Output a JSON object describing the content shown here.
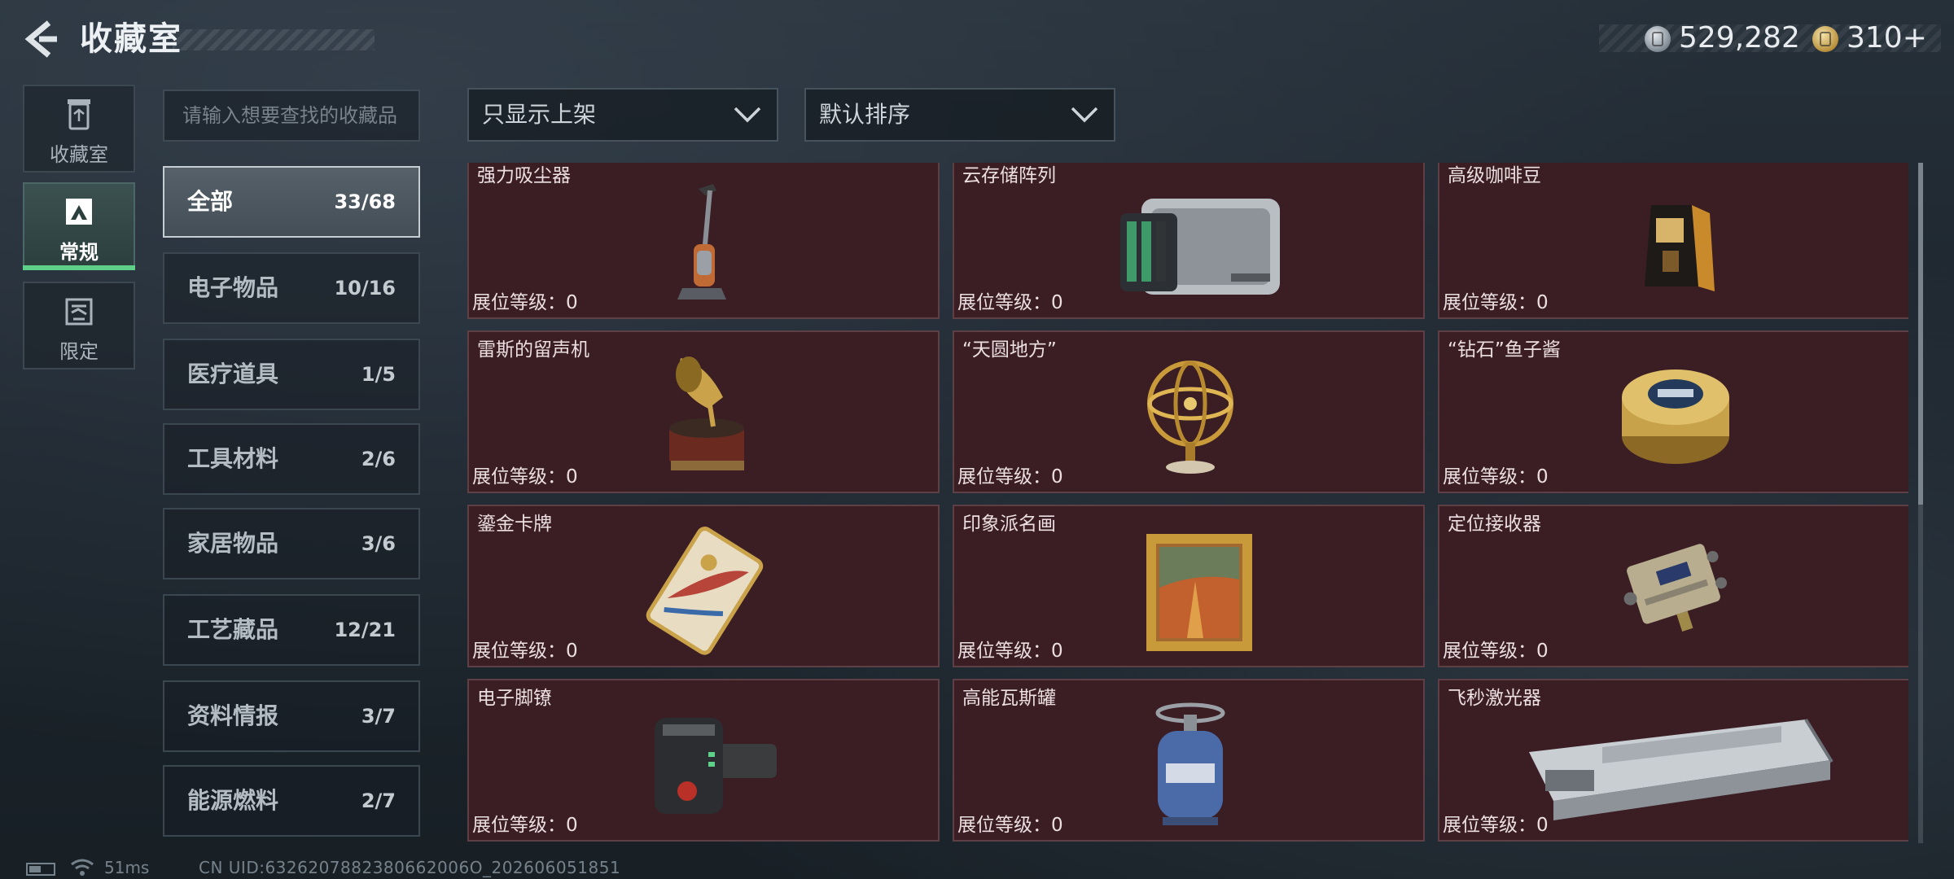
{
  "header": {
    "title": "收藏室",
    "currency_silver": "529,282",
    "currency_gold": "310+"
  },
  "nav": {
    "items": [
      {
        "label": "收藏室",
        "icon": "trash-can-icon"
      },
      {
        "label": "常规",
        "icon": "image-frame-icon",
        "selected": true
      },
      {
        "label": "限定",
        "icon": "limited-icon"
      }
    ]
  },
  "search": {
    "placeholder": "请输入想要查找的收藏品",
    "value": ""
  },
  "filters": {
    "filter_label": "只显示上架",
    "sort_label": "默认排序"
  },
  "categories": [
    {
      "name": "全部",
      "count": "33/68",
      "active": true
    },
    {
      "name": "电子物品",
      "count": "10/16"
    },
    {
      "name": "医疗道具",
      "count": "1/5"
    },
    {
      "name": "工具材料",
      "count": "2/6"
    },
    {
      "name": "家居物品",
      "count": "3/6"
    },
    {
      "name": "工艺藏品",
      "count": "12/21"
    },
    {
      "name": "资料情报",
      "count": "3/7"
    },
    {
      "name": "能源燃料",
      "count": "2/7"
    }
  ],
  "items": [
    {
      "name": "强力吸尘器",
      "level": "展位等级：0",
      "icon": "vacuum-cleaner-icon"
    },
    {
      "name": "云存储阵列",
      "level": "展位等级：0",
      "icon": "storage-array-icon"
    },
    {
      "name": "高级咖啡豆",
      "level": "展位等级：0",
      "icon": "coffee-bag-icon"
    },
    {
      "name": "雷斯的留声机",
      "level": "展位等级：0",
      "icon": "gramophone-icon"
    },
    {
      "name": "“天圆地方”",
      "level": "展位等级：0",
      "icon": "armillary-sphere-icon"
    },
    {
      "name": "“钻石”鱼子酱",
      "level": "展位等级：0",
      "icon": "caviar-tin-icon"
    },
    {
      "name": "鎏金卡牌",
      "level": "展位等级：0",
      "icon": "gilded-card-icon"
    },
    {
      "name": "印象派名画",
      "level": "展位等级：0",
      "icon": "framed-painting-icon"
    },
    {
      "name": "定位接收器",
      "level": "展位等级：0",
      "icon": "locator-receiver-icon"
    },
    {
      "name": "电子脚镣",
      "level": "展位等级：0",
      "icon": "ankle-monitor-icon"
    },
    {
      "name": "高能瓦斯罐",
      "level": "展位等级：0",
      "icon": "gas-canister-icon"
    },
    {
      "name": "飞秒激光器",
      "level": "展位等级：0",
      "icon": "laser-device-icon"
    }
  ],
  "footer": {
    "ping": "51ms",
    "uid": "CN UID:6326207882380662006O_202606051851"
  },
  "colors": {
    "card_bg": "#3a1e24",
    "active_green": "#5fd08a"
  }
}
